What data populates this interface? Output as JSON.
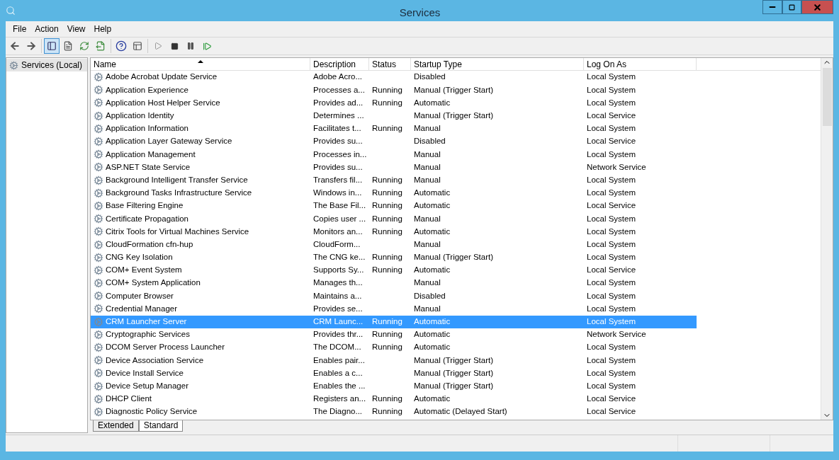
{
  "window": {
    "title": "Services"
  },
  "menu": [
    "File",
    "Action",
    "View",
    "Help"
  ],
  "tree": [
    {
      "label": "Services (Local)",
      "selected": true
    }
  ],
  "table": {
    "columns": [
      {
        "label": "Name",
        "sorted": true
      },
      {
        "label": "Description",
        "sorted": false
      },
      {
        "label": "Status",
        "sorted": false
      },
      {
        "label": "Startup Type",
        "sorted": false
      },
      {
        "label": "Log On As",
        "sorted": false
      }
    ],
    "rows": [
      {
        "cells": [
          "Adobe Acrobat Update Service",
          "Adobe Acro...",
          "",
          "Disabled",
          "Local System"
        ],
        "selected": false
      },
      {
        "cells": [
          "Application Experience",
          "Processes a...",
          "Running",
          "Manual (Trigger Start)",
          "Local System"
        ],
        "selected": false
      },
      {
        "cells": [
          "Application Host Helper Service",
          "Provides ad...",
          "Running",
          "Automatic",
          "Local System"
        ],
        "selected": false
      },
      {
        "cells": [
          "Application Identity",
          "Determines ...",
          "",
          "Manual (Trigger Start)",
          "Local Service"
        ],
        "selected": false
      },
      {
        "cells": [
          "Application Information",
          "Facilitates t...",
          "Running",
          "Manual",
          "Local System"
        ],
        "selected": false
      },
      {
        "cells": [
          "Application Layer Gateway Service",
          "Provides su...",
          "",
          "Disabled",
          "Local Service"
        ],
        "selected": false
      },
      {
        "cells": [
          "Application Management",
          "Processes in...",
          "",
          "Manual",
          "Local System"
        ],
        "selected": false
      },
      {
        "cells": [
          "ASP.NET State Service",
          "Provides su...",
          "",
          "Manual",
          "Network Service"
        ],
        "selected": false
      },
      {
        "cells": [
          "Background Intelligent Transfer Service",
          "Transfers fil...",
          "Running",
          "Manual",
          "Local System"
        ],
        "selected": false
      },
      {
        "cells": [
          "Background Tasks Infrastructure Service",
          "Windows in...",
          "Running",
          "Automatic",
          "Local System"
        ],
        "selected": false
      },
      {
        "cells": [
          "Base Filtering Engine",
          "The Base Fil...",
          "Running",
          "Automatic",
          "Local Service"
        ],
        "selected": false
      },
      {
        "cells": [
          "Certificate Propagation",
          "Copies user ...",
          "Running",
          "Manual",
          "Local System"
        ],
        "selected": false
      },
      {
        "cells": [
          "Citrix Tools for Virtual Machines Service",
          "Monitors an...",
          "Running",
          "Automatic",
          "Local System"
        ],
        "selected": false
      },
      {
        "cells": [
          "CloudFormation cfn-hup",
          "CloudForm...",
          "",
          "Manual",
          "Local System"
        ],
        "selected": false
      },
      {
        "cells": [
          "CNG Key Isolation",
          "The CNG ke...",
          "Running",
          "Manual (Trigger Start)",
          "Local System"
        ],
        "selected": false
      },
      {
        "cells": [
          "COM+ Event System",
          "Supports Sy...",
          "Running",
          "Automatic",
          "Local Service"
        ],
        "selected": false
      },
      {
        "cells": [
          "COM+ System Application",
          "Manages th...",
          "",
          "Manual",
          "Local System"
        ],
        "selected": false
      },
      {
        "cells": [
          "Computer Browser",
          "Maintains a...",
          "",
          "Disabled",
          "Local System"
        ],
        "selected": false
      },
      {
        "cells": [
          "Credential Manager",
          "Provides se...",
          "",
          "Manual",
          "Local System"
        ],
        "selected": false
      },
      {
        "cells": [
          "CRM Launcher Server",
          "CRM Launc...",
          "Running",
          "Automatic",
          "Local System"
        ],
        "selected": true
      },
      {
        "cells": [
          "Cryptographic Services",
          "Provides thr...",
          "Running",
          "Automatic",
          "Network Service"
        ],
        "selected": false
      },
      {
        "cells": [
          "DCOM Server Process Launcher",
          "The DCOM...",
          "Running",
          "Automatic",
          "Local System"
        ],
        "selected": false
      },
      {
        "cells": [
          "Device Association Service",
          "Enables pair...",
          "",
          "Manual (Trigger Start)",
          "Local System"
        ],
        "selected": false
      },
      {
        "cells": [
          "Device Install Service",
          "Enables a c...",
          "",
          "Manual (Trigger Start)",
          "Local System"
        ],
        "selected": false
      },
      {
        "cells": [
          "Device Setup Manager",
          "Enables the ...",
          "",
          "Manual (Trigger Start)",
          "Local System"
        ],
        "selected": false
      },
      {
        "cells": [
          "DHCP Client",
          "Registers an...",
          "Running",
          "Automatic",
          "Local Service"
        ],
        "selected": false
      },
      {
        "cells": [
          "Diagnostic Policy Service",
          "The Diagno...",
          "Running",
          "Automatic (Delayed Start)",
          "Local Service"
        ],
        "selected": false
      }
    ]
  },
  "view_tabs": [
    {
      "label": "Extended",
      "selected": false
    },
    {
      "label": "Standard",
      "selected": true
    }
  ]
}
